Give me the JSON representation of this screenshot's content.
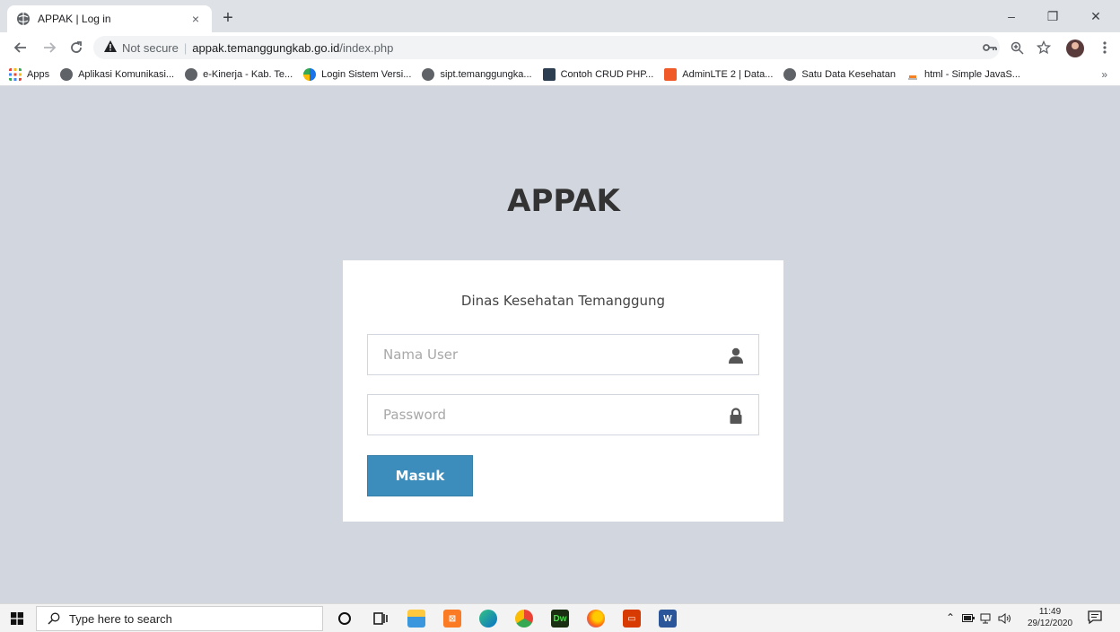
{
  "browser": {
    "tab_title": "APPAK | Log in",
    "tab_close": "×",
    "new_tab": "+",
    "window_minimize": "–",
    "window_restore": "❐",
    "window_close": "✕",
    "security_label": "Not secure",
    "url_host": "appak.temanggungkab.go.id",
    "url_path": "/index.php",
    "bookmarks": [
      {
        "label": "Apps",
        "color": "#ea4335"
      },
      {
        "label": "Aplikasi Komunikasi...",
        "color": "#5f6368"
      },
      {
        "label": "e-Kinerja - Kab. Te...",
        "color": "#5f6368"
      },
      {
        "label": "Login Sistem Versi...",
        "color": "#1a73e8"
      },
      {
        "label": "sipt.temanggungka...",
        "color": "#5f6368"
      },
      {
        "label": "Contoh CRUD PHP...",
        "color": "#2d3e50"
      },
      {
        "label": "AdminLTE 2 | Data...",
        "color": "#f05a28"
      },
      {
        "label": "Satu Data Kesehatan",
        "color": "#5f6368"
      },
      {
        "label": "html - Simple JavaS...",
        "color": "#f48024"
      }
    ],
    "bookmarks_more": "»"
  },
  "page": {
    "brand": "APPAK",
    "login_message": "Dinas Kesehatan Temanggung",
    "username_placeholder": "Nama User",
    "password_placeholder": "Password",
    "submit_label": "Masuk",
    "accent_color": "#3c8dbc"
  },
  "taskbar": {
    "search_placeholder": "Type here to search",
    "time": "11:49",
    "date": "29/12/2020"
  }
}
